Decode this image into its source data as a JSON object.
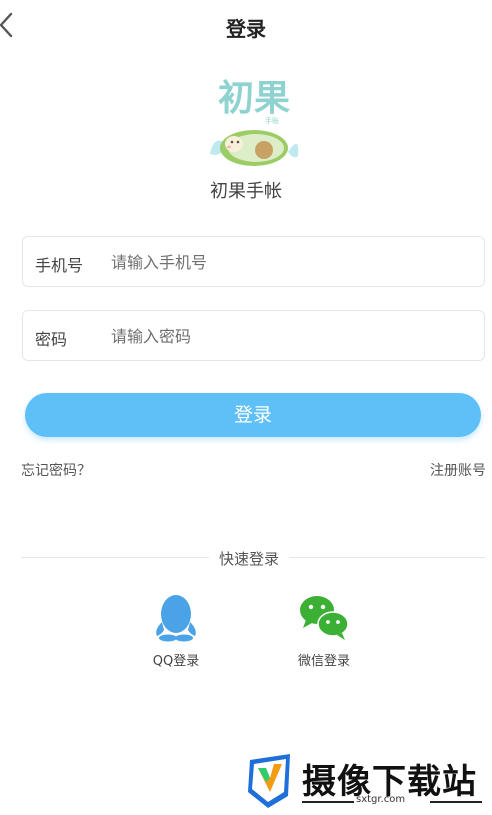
{
  "header": {
    "title": "登录",
    "back_icon": "chevron-left-icon"
  },
  "app": {
    "name": "初果手帐",
    "logo_text": "初果",
    "logo_sub": "手账"
  },
  "form": {
    "phone": {
      "label": "手机号",
      "placeholder": "请输入手机号",
      "value": ""
    },
    "password": {
      "label": "密码",
      "placeholder": "请输入密码",
      "value": ""
    },
    "submit_label": "登录"
  },
  "links": {
    "forgot": "忘记密码？",
    "register": "注册账号"
  },
  "quick_login": {
    "title": "快速登录",
    "options": [
      {
        "label": "QQ登录",
        "icon": "qq-icon"
      },
      {
        "label": "微信登录",
        "icon": "wechat-icon"
      }
    ]
  },
  "watermark": {
    "text": "摄像下载站",
    "url": "sxtgr.com"
  },
  "colors": {
    "accent": "#5fc0f7",
    "wechat": "#3cb034",
    "qq": "#4aa3e6",
    "logo_text": "#8fd3d1"
  }
}
